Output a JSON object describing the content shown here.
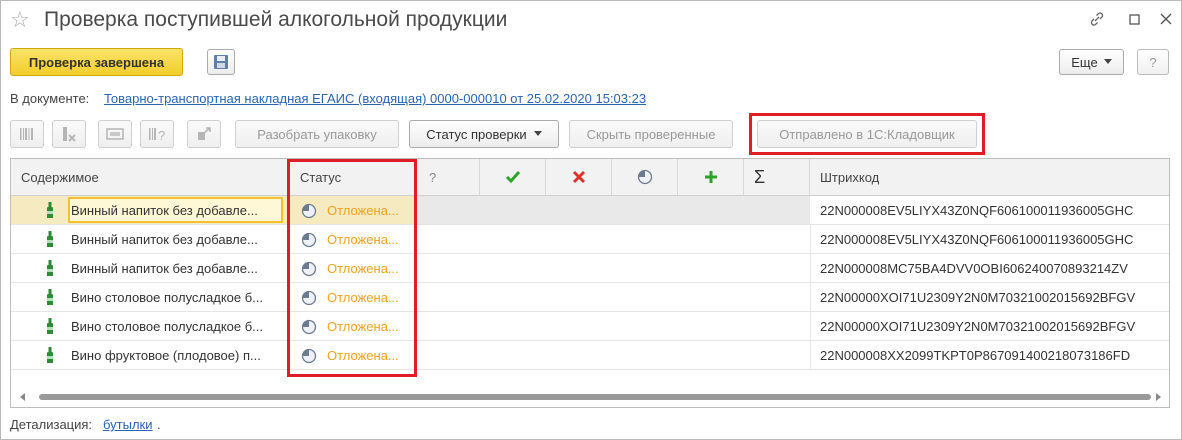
{
  "window": {
    "title": "Проверка поступившей алкогольной продукции"
  },
  "toolbar": {
    "finish_label": "Проверка завершена",
    "more_label": "Еще",
    "help_label": "?"
  },
  "document": {
    "label": "В документе:",
    "link": "Товарно-транспортная накладная ЕГАИС (входящая) 0000-000010 от 25.02.2020 15:03:23"
  },
  "actions": {
    "unpack": "Разобрать упаковку",
    "check_status": "Статус проверки",
    "hide_checked": "Скрыть проверенные",
    "sent_to": "Отправлено в 1С:Кладовщик"
  },
  "table": {
    "columns": {
      "content": "Содержимое",
      "status": "Статус",
      "question": "?",
      "barcode": "Штрихкод"
    },
    "rows": [
      {
        "content": "Винный напиток без добавле...",
        "status": "Отложена...",
        "barcode": "22N000008EV5LIYX43Z0NQF606100011936005GHC"
      },
      {
        "content": "Винный напиток без добавле...",
        "status": "Отложена...",
        "barcode": "22N000008EV5LIYX43Z0NQF606100011936005GHC"
      },
      {
        "content": "Винный напиток без добавле...",
        "status": "Отложена...",
        "barcode": "22N000008MC75BA4DVV0OBI606240070893214ZV"
      },
      {
        "content": "Вино столовое полусладкое б...",
        "status": "Отложена...",
        "barcode": "22N00000XOI71U2309Y2N0M70321002015692BFGV"
      },
      {
        "content": "Вино столовое полусладкое б...",
        "status": "Отложена...",
        "barcode": "22N00000XOI71U2309Y2N0M70321002015692BFGV"
      },
      {
        "content": "Вино фруктовое (плодовое) п...",
        "status": "Отложена...",
        "barcode": "22N000008XX2099TKPT0P867091400218073186FD"
      }
    ]
  },
  "footer": {
    "detail_label": "Детализация:",
    "detail_link": "бутылки",
    "detail_suffix": "."
  },
  "colors": {
    "accent_yellow": "#f3cd2b",
    "link_blue": "#2a64b0",
    "status_orange": "#f0a21e",
    "highlight_red": "#e01d25",
    "check_green": "#2aa52a",
    "cross_red": "#d9342b"
  }
}
